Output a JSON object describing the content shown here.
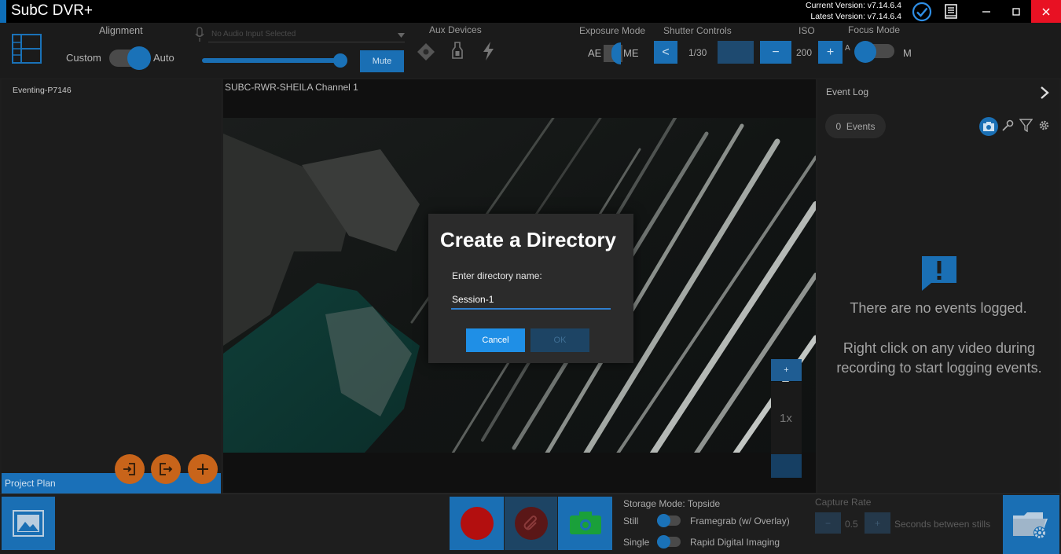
{
  "window": {
    "title": "SubC DVR+",
    "current_version": "Current Version: v7.14.6.4",
    "latest_version": "Latest Version: v7.14.6.4"
  },
  "toolbar": {
    "alignment_label": "Alignment",
    "alignment_left": "Custom",
    "alignment_right": "Auto",
    "audio_placeholder": "No Audio Input Selected",
    "audio_volume": 0.98,
    "mute_label": "Mute",
    "aux_label": "Aux Devices",
    "exposure_label": "Exposure Mode",
    "exposure_ae": "AE",
    "exposure_me": "ME",
    "shutter_label": "Shutter Controls",
    "shutter_prev": "<",
    "shutter_value": "1/30",
    "iso_label": "ISO",
    "iso_minus": "−",
    "iso_value": "200",
    "iso_plus": "+",
    "focus_label": "Focus Mode",
    "focus_a": "A",
    "focus_m": "M"
  },
  "left_panel": {
    "item": "Eventing-P7146",
    "project_plan": "Project Plan"
  },
  "video": {
    "channel_label": "SUBC-RWR-SHEILA Channel 1",
    "zoom_plus": "+",
    "zoom_level": "1x"
  },
  "event_log": {
    "title": "Event Log",
    "count": "0  Events",
    "empty_title": "There are no events logged.",
    "empty_hint": "Right click on any video during recording to start logging events."
  },
  "dialog": {
    "title": "Create a Directory",
    "prompt": "Enter directory name:",
    "value": "Session-1",
    "cancel": "Cancel",
    "ok": "OK"
  },
  "bottom": {
    "storage_mode": "Storage Mode: Topside",
    "still_label": "Still",
    "framegrab": "Framegrab (w/ Overlay)",
    "single_label": "Single",
    "rapid": "Rapid Digital Imaging",
    "capture_rate": "Capture Rate",
    "capture_minus": "−",
    "capture_value": "0.5",
    "capture_plus": "+",
    "capture_unit": "Seconds between stills"
  },
  "colors": {
    "accent": "#1a6fb4",
    "close": "#e81123",
    "record": "#b30f0f",
    "camera": "#1aa03a",
    "orange": "#c8641a"
  }
}
